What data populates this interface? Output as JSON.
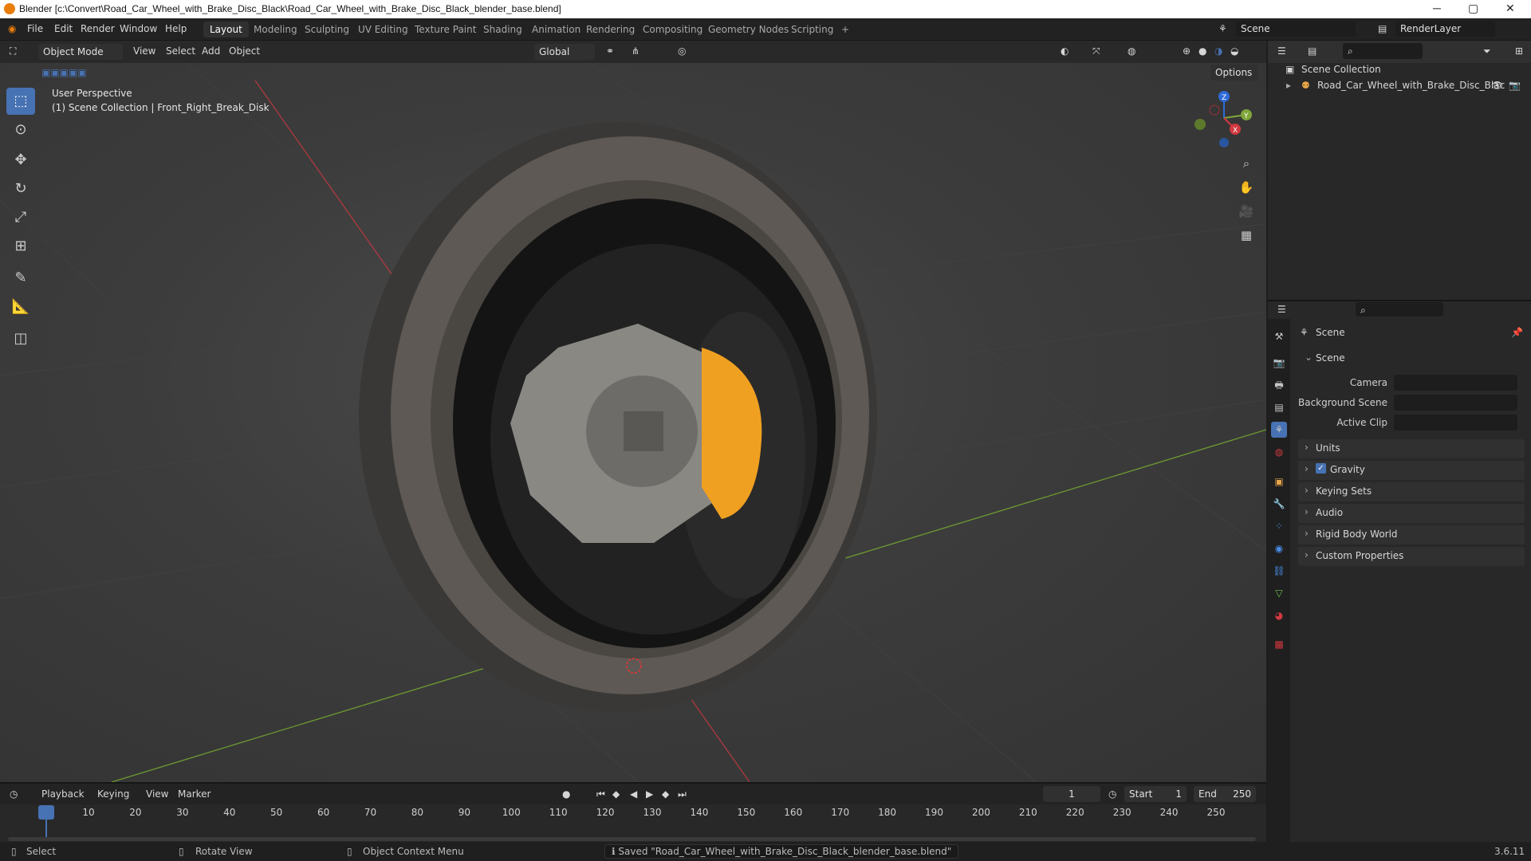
{
  "titlebar": {
    "title": "Blender [c:\\Convert\\Road_Car_Wheel_with_Brake_Disc_Black\\Road_Car_Wheel_with_Brake_Disc_Black_blender_base.blend]",
    "min": "─",
    "max": "▢",
    "close": "✕"
  },
  "menus": [
    "File",
    "Edit",
    "Render",
    "Window",
    "Help"
  ],
  "workspaces": [
    "Layout",
    "Modeling",
    "Sculpting",
    "UV Editing",
    "Texture Paint",
    "Shading",
    "Animation",
    "Rendering",
    "Compositing",
    "Geometry Nodes",
    "Scripting",
    "+"
  ],
  "scene_name": "Scene",
  "renderlayer": "RenderLayer",
  "viewport": {
    "mode": "Object Mode",
    "menus": [
      "View",
      "Select",
      "Add",
      "Object"
    ],
    "transform": "Global",
    "options": "Options",
    "perspective": "User Perspective",
    "collection_info": "(1) Scene Collection | Front_Right_Break_Disk",
    "axes": {
      "x": "X",
      "y": "Y",
      "z": "Z"
    }
  },
  "outliner": {
    "root": "Scene Collection",
    "item": "Road_Car_Wheel_with_Brake_Disc_Blac"
  },
  "properties": {
    "header": "Scene",
    "section": "Scene",
    "fields": [
      {
        "label": "Camera"
      },
      {
        "label": "Background Scene"
      },
      {
        "label": "Active Clip"
      }
    ],
    "panels": [
      "Units",
      "Gravity",
      "Keying Sets",
      "Audio",
      "Rigid Body World",
      "Custom Properties"
    ]
  },
  "timeline": {
    "menus": [
      "Playback",
      "Keying",
      "View",
      "Marker"
    ],
    "current_frame": "1",
    "start_label": "Start",
    "start": "1",
    "end_label": "End",
    "end": "250",
    "ticks": [
      "1",
      "10",
      "20",
      "30",
      "40",
      "50",
      "60",
      "70",
      "80",
      "90",
      "100",
      "110",
      "120",
      "130",
      "140",
      "150",
      "160",
      "170",
      "180",
      "190",
      "200",
      "210",
      "220",
      "230",
      "240",
      "250"
    ]
  },
  "status": {
    "select": "Select",
    "rotate": "Rotate View",
    "context": "Object Context Menu",
    "saved": "Saved \"Road_Car_Wheel_with_Brake_Disc_Black_blender_base.blend\"",
    "version": "3.6.11"
  },
  "colors": {
    "accent": "#4772b3",
    "caliper": "#f0a020",
    "x_axis": "#c0393f",
    "y_axis": "#7fa63a"
  }
}
